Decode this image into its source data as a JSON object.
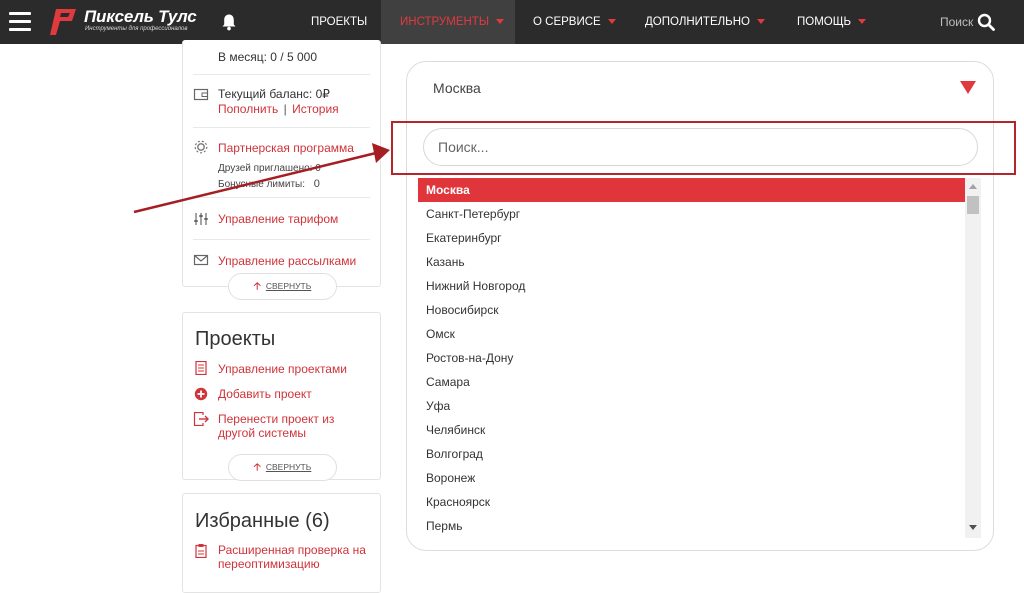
{
  "header": {
    "logo_name": "Пиксель Тулс",
    "logo_tagline": "Инструменты для профессионалов",
    "nav": [
      {
        "label": "Проекты",
        "active": false,
        "caret": false
      },
      {
        "label": "Инструменты",
        "active": true,
        "caret": true
      },
      {
        "label": "О сервисе",
        "active": false,
        "caret": true
      },
      {
        "label": "Дополнительно",
        "active": false,
        "caret": true
      },
      {
        "label": "Помощь",
        "active": false,
        "caret": true
      }
    ],
    "search_label": "Поиск"
  },
  "account_card": {
    "monthly_limit": "В месяц: 0 / 5 000",
    "balance": "Текущий баланс: 0₽",
    "topup_link": "Пополнить",
    "separator": "|",
    "history_link": "История",
    "partner_link": "Партнерская программа",
    "friends_invited": "Друзей приглашено: 0",
    "bonus_limits_label": "Бонусные лимиты:",
    "bonus_limits_value": "0",
    "tariff_link": "Управление тарифом",
    "mailing_link": "Управление рассылками",
    "collapse_label": "свернуть"
  },
  "projects_card": {
    "title": "Проекты",
    "manage_link": "Управление проектами",
    "add_link": "Добавить проект",
    "transfer_link": "Перенести проект из другой системы",
    "collapse_label": "свернуть"
  },
  "favorites_card": {
    "title": "Избранные (6)",
    "item1": "Расширенная проверка на переоптимизацию"
  },
  "dropdown": {
    "selected_value": "Москва",
    "search_placeholder": "Поиск...",
    "options": [
      "Москва",
      "Санкт-Петербург",
      "Екатеринбург",
      "Казань",
      "Нижний Новгород",
      "Новосибирск",
      "Омск",
      "Ростов-на-Дону",
      "Самара",
      "Уфа",
      "Челябинск",
      "Волгоград",
      "Воронеж",
      "Красноярск",
      "Пермь"
    ]
  },
  "colors": {
    "accent": "#e03a3e",
    "nav_bg": "#2b2b2b",
    "annotation": "#b3262b"
  }
}
